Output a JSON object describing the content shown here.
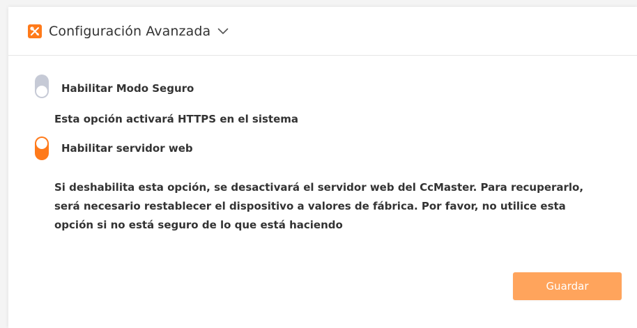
{
  "header": {
    "title": "Configuración Avanzada",
    "icon": "tools-icon",
    "chevron": "chevron-down-icon",
    "accent_color": "#ff7a1a"
  },
  "settings": [
    {
      "label": "Habilitar Modo Seguro",
      "enabled": false,
      "description": "Esta opción activará HTTPS en el sistema"
    },
    {
      "label": "Habilitar servidor web",
      "enabled": true,
      "description": "Si deshabilita esta opción, se desactivará el servidor web del CcMaster. Para recuperarlo, será necesario restablecer el dispositivo a valores de fábrica. Por favor, no utilice esta opción si no está seguro de lo que está haciendo"
    }
  ],
  "actions": {
    "save_label": "Guardar",
    "save_color": "#ffa45c"
  }
}
